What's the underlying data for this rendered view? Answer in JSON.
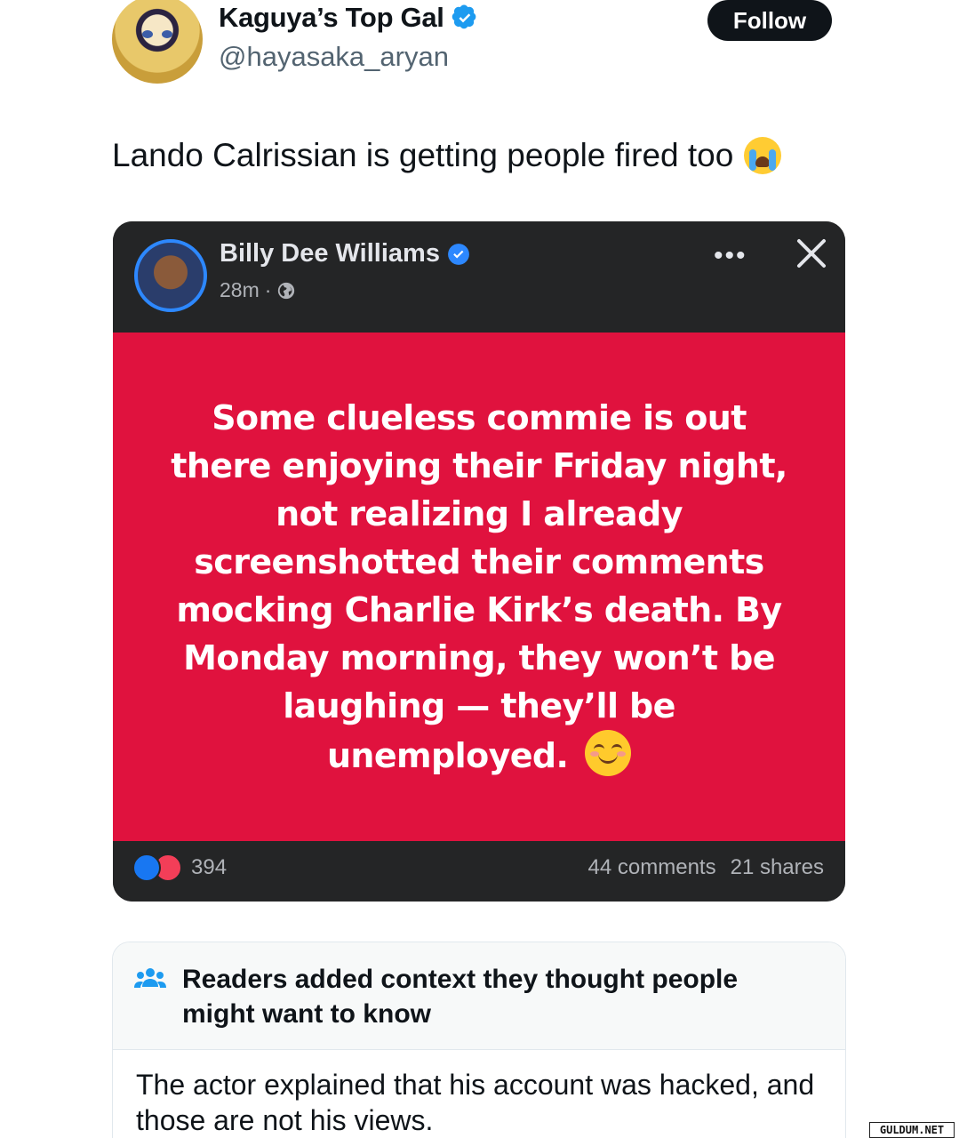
{
  "tweet": {
    "author": {
      "display_name": "Kaguya’s Top Gal",
      "handle": "@hayasaka_aryan",
      "verified": true,
      "avatar_icon": "anime-avatar"
    },
    "follow_label": "Follow",
    "text": "Lando Calrissian is getting people fired too",
    "text_emoji": "loudly-crying-face-emoji",
    "colors": {
      "follow_bg": "#0f1419",
      "verified_blue": "#1d9bf0"
    }
  },
  "embedded_post": {
    "author": "Billy Dee Williams",
    "verified": true,
    "time": "28m",
    "dot": "·",
    "audience_icon": "globe-icon",
    "more_label": "•••",
    "close_icon": "close-icon",
    "body_lines": [
      "Some clueless commie is out",
      "there enjoying their Friday night,",
      "not realizing I already",
      "screenshotted their comments",
      "mocking Charlie Kirk’s death. By",
      "Monday morning, they won’t be",
      "laughing — they’ll be",
      "unemployed."
    ],
    "body_emoji": "smiling-face-emoji",
    "reaction_count": "394",
    "comments": "44 comments",
    "shares": "21 shares",
    "colors": {
      "post_bg": "#e0123e",
      "card_bg": "#242526",
      "like": "#1877f2",
      "love": "#f33e58"
    }
  },
  "community_note": {
    "icon": "people-icon",
    "title": "Readers added context they thought people might want to know",
    "body": "The actor explained that his account was hacked, and those are not his views."
  },
  "watermark": "GULDUM.NET"
}
